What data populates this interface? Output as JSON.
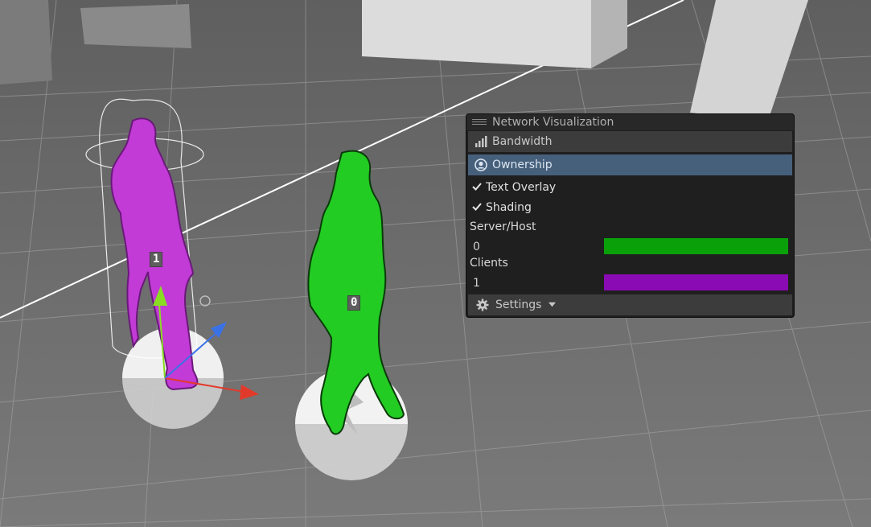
{
  "scene": {
    "object_labels": {
      "purple_player": "1",
      "green_player": "0"
    },
    "colors": {
      "ground": "#6e6e6e",
      "grid_line": "#a9a9a9",
      "purple_player": "#c23bd6",
      "green_player": "#22cc22",
      "x_axis": "#e23a2a",
      "y_axis": "#88dd22",
      "z_axis": "#3a72e6"
    }
  },
  "panel": {
    "title": "Network Visualization",
    "buttons": {
      "bandwidth": {
        "label": "Bandwidth",
        "icon": "signal-bars-icon"
      },
      "ownership": {
        "label": "Ownership",
        "icon": "user-circle-icon",
        "active": true
      }
    },
    "toggles": {
      "text_overlay": {
        "label": "Text Overlay",
        "checked": true
      },
      "shading": {
        "label": "Shading",
        "checked": true
      }
    },
    "sections": {
      "server_host": {
        "label": "Server/Host",
        "id": "0",
        "color": "#0aa00a"
      },
      "clients": {
        "label": "Clients",
        "id": "1",
        "color": "#8a0ab4"
      }
    },
    "settings": {
      "label": "Settings",
      "icon": "gear-icon",
      "dropdown_icon": "caret-down-icon"
    }
  }
}
